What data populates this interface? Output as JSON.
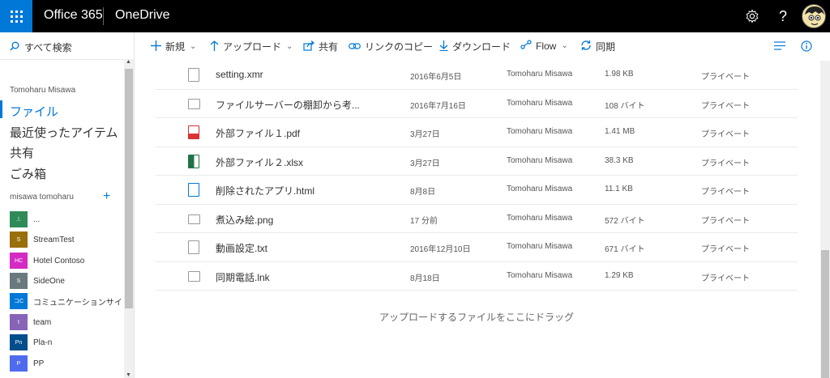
{
  "header": {
    "brand": "Office 365",
    "app": "OneDrive",
    "icons": [
      "waffle-icon",
      "gear-icon",
      "help-icon",
      "avatar"
    ]
  },
  "leftnav": {
    "search_label": "すべて検索",
    "user_name": "Tomoharu Misawa",
    "items": [
      {
        "label": "ファイル",
        "active": true
      },
      {
        "label": "最近使ったアイテム",
        "active": false
      },
      {
        "label": "共有",
        "active": false
      },
      {
        "label": "ごみ箱",
        "active": false
      }
    ],
    "group_heading": "misawa tomoharu",
    "group_add": "+",
    "sites": [
      {
        "abbr": ".!.",
        "label": "...",
        "color": "#2e8b57"
      },
      {
        "abbr": "S",
        "label": "StreamTest",
        "color": "#986f0b"
      },
      {
        "abbr": "HC",
        "label": "Hotel Contoso",
        "color": "#d42bc3"
      },
      {
        "abbr": "S",
        "label": "SideOne",
        "color": "#69797e"
      },
      {
        "abbr": "コC",
        "label": "コミュニケーションサイ",
        "color": "#0078d7"
      },
      {
        "abbr": "t",
        "label": "team",
        "color": "#8764b8"
      },
      {
        "abbr": "Pn",
        "label": "Pla-n",
        "color": "#004e8c"
      },
      {
        "abbr": "P",
        "label": "PP",
        "color": "#4f6bed"
      }
    ]
  },
  "commands": {
    "new": "新規",
    "upload": "アップロード",
    "share": "共有",
    "copy_link": "リンクのコピー",
    "download": "ダウンロード",
    "flow": "Flow",
    "sync": "同期"
  },
  "files": [
    {
      "name": "setting.xmr",
      "modified": "2016年6月5日",
      "owner": "Tomoharu Misawa",
      "size": "1.98 KB",
      "sharing": "プライベート",
      "icon": "generic-file-icon"
    },
    {
      "name": "ファイルサーバーの棚卸から考...",
      "modified": "2016年7月16日",
      "owner": "Tomoharu Misawa",
      "size": "108 バイト",
      "sharing": "プライベート",
      "icon": "link-file-icon"
    },
    {
      "name": "外部ファイル１.pdf",
      "modified": "3月27日",
      "owner": "Tomoharu Misawa",
      "size": "1.41 MB",
      "sharing": "プライベート",
      "icon": "pdf-file-icon"
    },
    {
      "name": "外部ファイル２.xlsx",
      "modified": "3月27日",
      "owner": "Tomoharu Misawa",
      "size": "38.3 KB",
      "sharing": "プライベート",
      "icon": "excel-file-icon"
    },
    {
      "name": "削除されたアプリ.html",
      "modified": "8月8日",
      "owner": "Tomoharu Misawa",
      "size": "11.1 KB",
      "sharing": "プライベート",
      "icon": "html-file-icon"
    },
    {
      "name": "煮込み絵.png",
      "modified": "17 分前",
      "owner": "Tomoharu Misawa",
      "size": "572 バイト",
      "sharing": "プライベート",
      "icon": "image-file-icon"
    },
    {
      "name": "動画設定.txt",
      "modified": "2016年12月10日",
      "owner": "Tomoharu Misawa",
      "size": "671 バイト",
      "sharing": "プライベート",
      "icon": "text-file-icon"
    },
    {
      "name": "同期電話.lnk",
      "modified": "8月18日",
      "owner": "Tomoharu Misawa",
      "size": "1.29 KB",
      "sharing": "プライベート",
      "icon": "link-file-icon"
    }
  ],
  "drop_message": "アップロードするファイルをここにドラッグ",
  "colors": {
    "accent": "#0078d7",
    "topbar": "#000000"
  }
}
